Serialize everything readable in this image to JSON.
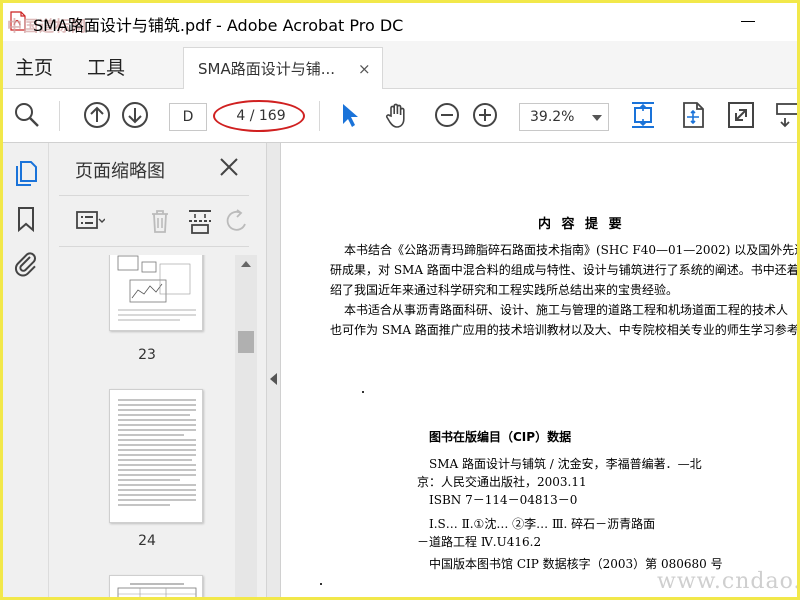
{
  "window": {
    "title": "SMA路面设计与铺筑.pdf - Adobe Acrobat Pro DC",
    "watermark_top_left": "中国道标网"
  },
  "tabs": {
    "home": "主页",
    "tools": "工具",
    "document_tab": "SMA路面设计与铺...",
    "close_symbol": "×"
  },
  "toolbar": {
    "page_input_value": "D",
    "page_count": "4 / 169",
    "zoom_value": "39.2%",
    "highlight_color": "#d02020",
    "accent_color": "#1a73d9"
  },
  "thumbnails": {
    "panel_title": "页面缩略图",
    "pages": [
      {
        "number": "23"
      },
      {
        "number": "24"
      }
    ]
  },
  "document": {
    "heading": "内 容 提 要",
    "summary_lines": [
      "本书结合《公路沥青玛蹄脂碎石路面技术指南》(SHC F40—01—2002) 以及国外先进的",
      "研成果，对 SMA 路面中混合料的组成与特性、设计与铺筑进行了系统的阐述。书中还着重",
      "绍了我国近年来通过科学研究和工程实践所总结出来的宝贵经验。",
      "本书适合从事沥青路面科研、设计、施工与管理的道路工程和机场道面工程的技术人",
      "也可作为 SMA 路面推广应用的技术培训教材以及大、中专院校相关专业的师生学习参考。"
    ],
    "cip_title": "图书在版编目（CIP）数据",
    "cip_lines": [
      "SMA 路面设计与铺筑 / 沈金安，李福普编著．—北",
      "京：人民交通出版社，2003.11",
      "ISBN 7－114－04813－0",
      "Ⅰ.S…  Ⅱ.①沈…  ②李…   Ⅲ. 碎石－沥青路面",
      "－道路工程   Ⅳ.U416.2",
      "中国版本图书馆 CIP 数据核字（2003）第 080680 号"
    ],
    "watermark_bottom_right": "www.cndao.com"
  }
}
